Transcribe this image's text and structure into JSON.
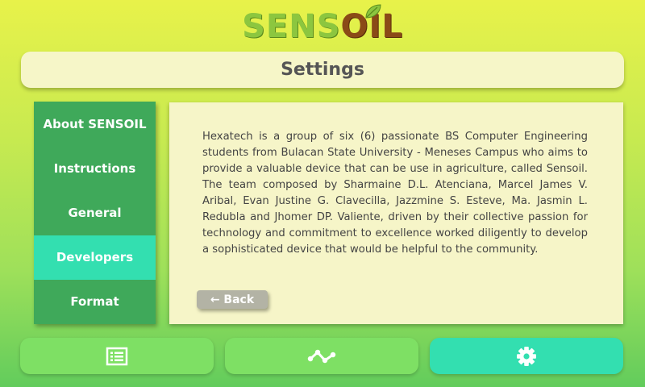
{
  "app": {
    "logo_part1": "SENS",
    "logo_part2": "OIL",
    "page_title": "Settings"
  },
  "sidebar": {
    "items": [
      {
        "label": "About SENSOIL"
      },
      {
        "label": "Instructions"
      },
      {
        "label": "General"
      },
      {
        "label": "Developers",
        "active": true
      },
      {
        "label": "Format"
      }
    ]
  },
  "panel": {
    "body": "Hexatech is a group of six (6) passionate BS Computer Engineering students from Bulacan State University - Meneses Campus who aims to provide a valuable device that can be use in agriculture, called Sensoil.  The team composed by Sharmaine D.L. Atenciana, Marcel James V. Aribal, Evan Justine G. Clavecilla, Jazzmine S. Esteve, Ma. Jasmin L. Redubla and Jhomer DP. Valiente, driven by their collective passion for technology and commitment to excellence worked diligently to develop a sophisticated device that would be helpful to the community.",
    "back_label": "← Back"
  },
  "bottom_nav": {
    "icons": [
      "list-icon",
      "graph-icon",
      "gear-icon"
    ],
    "active": "gear-icon"
  },
  "colors": {
    "sidebar": "#3fa95a",
    "active": "#33dfb0",
    "nav_button": "#7ee064",
    "panel": "#f6f5c8"
  }
}
